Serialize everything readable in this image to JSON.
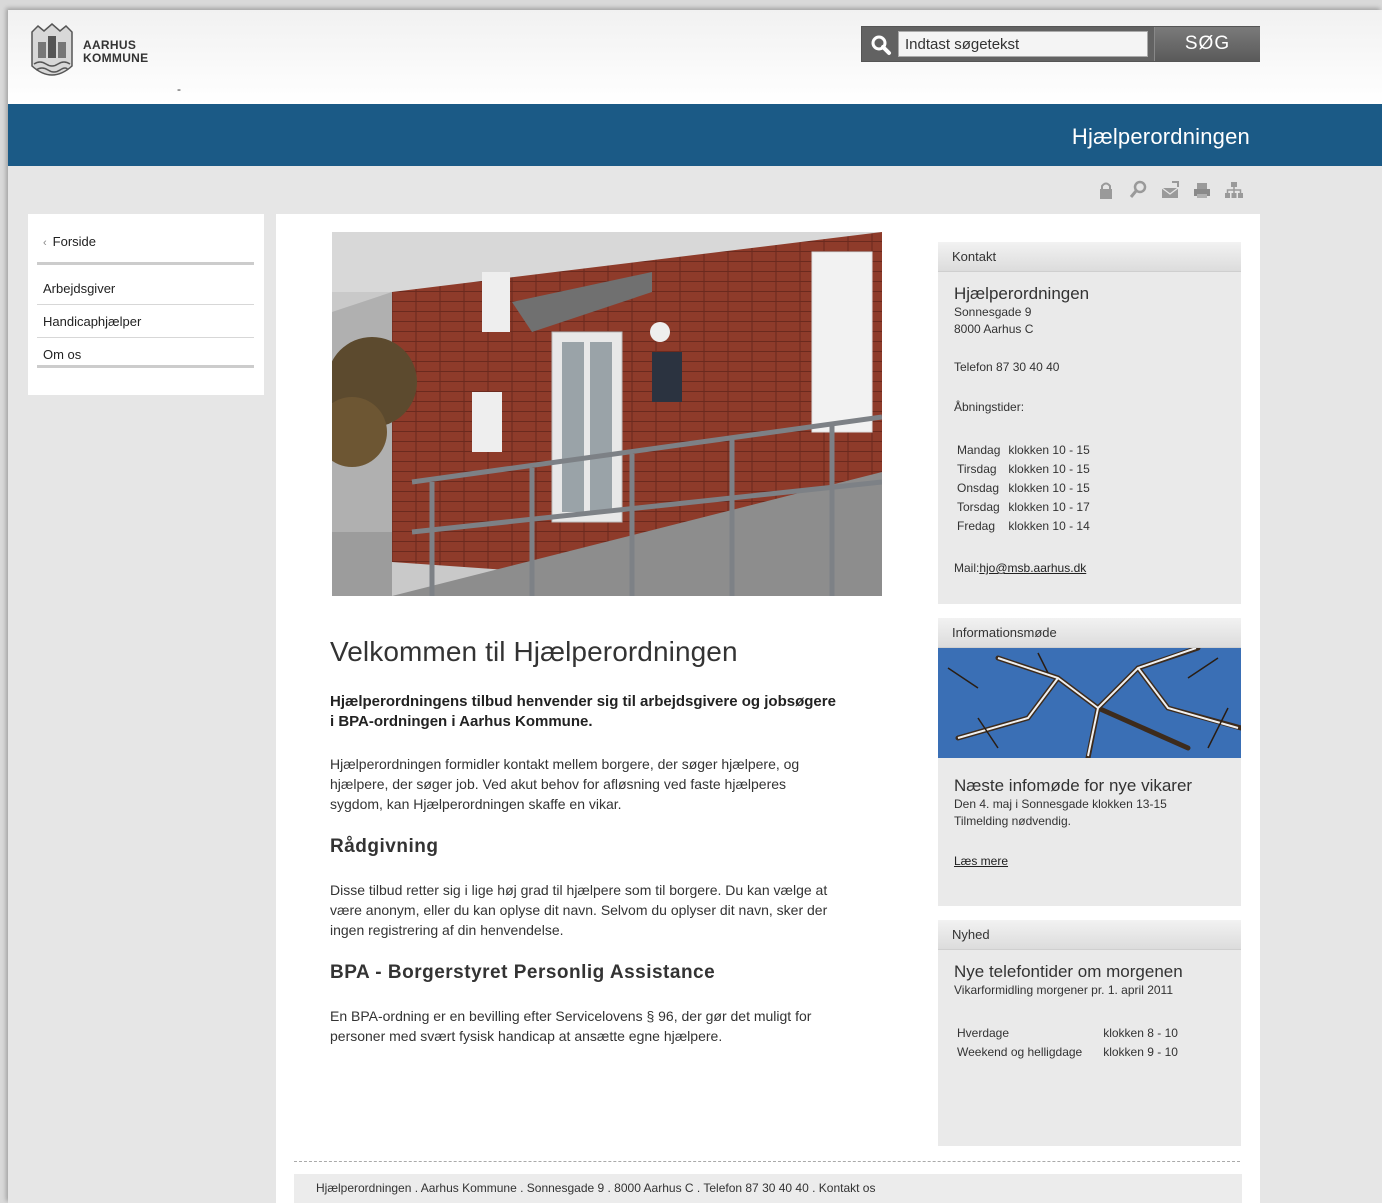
{
  "header": {
    "logo_line1": "AARHUS",
    "logo_line2": "KOMMUNE",
    "logo_dash": "-",
    "search_placeholder": "Indtast søgetekst",
    "search_button": "SØG"
  },
  "banner": {
    "title": "Hjælperordningen"
  },
  "toolbar": {
    "icons": [
      "lock-icon",
      "magnifier-icon",
      "mail-icon",
      "print-icon",
      "sitemap-icon"
    ]
  },
  "leftnav": {
    "home": "Forside",
    "items": [
      "Arbejdsgiver",
      "Handicaphjælper",
      "Om os"
    ]
  },
  "main": {
    "heading": "Velkommen til Hjælperordningen",
    "lead": "Hjælperordningens tilbud henvender sig til arbejdsgivere og jobsøgere i BPA-ordningen i Aarhus Kommune.",
    "intro": "Hjælperordningen formidler kontakt mellem borgere, der søger hjælpere, og hjælpere, der søger job. Ved akut behov for afløsning ved faste hjælperes sygdom, kan Hjælperordningen skaffe en vikar.",
    "section1_title": "Rådgivning",
    "section1_text": "Disse tilbud retter sig i lige høj grad til hjælpere som til borgere. Du kan vælge at være anonym, eller du kan oplyse dit navn. Selvom du oplyser dit navn, sker der ingen registrering af din henvendelse.",
    "section2_title": "BPA - Borgerstyret Personlig Assistance",
    "section2_text": "En BPA-ordning er en bevilling efter Servicelovens § 96, der gør det muligt for personer med svært fysisk handicap at ansætte egne hjælpere."
  },
  "contact": {
    "head": "Kontakt",
    "name": "Hjælperordningen",
    "street": "Sonnesgade 9",
    "city": "8000 Aarhus C",
    "phone": "Telefon 87 30 40 40",
    "hours_label": "Åbningstider:",
    "hours": [
      {
        "day": "Mandag",
        "time": "klokken 10 - 15"
      },
      {
        "day": "Tirsdag",
        "time": "klokken 10 - 15"
      },
      {
        "day": "Onsdag",
        "time": "klokken 10 - 15"
      },
      {
        "day": "Torsdag",
        "time": "klokken 10 - 17"
      },
      {
        "day": "Fredag",
        "time": "klokken 10 - 14"
      }
    ],
    "mail_label": "Mail:",
    "mail": "hjo@msb.aarhus.dk"
  },
  "info": {
    "head": "Informationsmøde",
    "title": "Næste infomøde for nye vikarer",
    "line1": "Den 4. maj i Sonnesgade klokken 13-15",
    "line2": "Tilmelding nødvendig.",
    "link": "Læs mere"
  },
  "news": {
    "head": "Nyhed",
    "title": "Nye telefontider om morgenen",
    "subtitle": "Vikarformidling morgener pr. 1. april 2011",
    "rows": [
      {
        "label": "Hverdage",
        "time": "klokken 8 - 10"
      },
      {
        "label": "Weekend og helligdage",
        "time": "klokken 9 - 10"
      }
    ]
  },
  "footer": {
    "text": "Hjælperordningen . Aarhus Kommune . Sonnesgade 9 . 8000 Aarhus C . Telefon 87 30 40 40 . Kontakt os"
  }
}
